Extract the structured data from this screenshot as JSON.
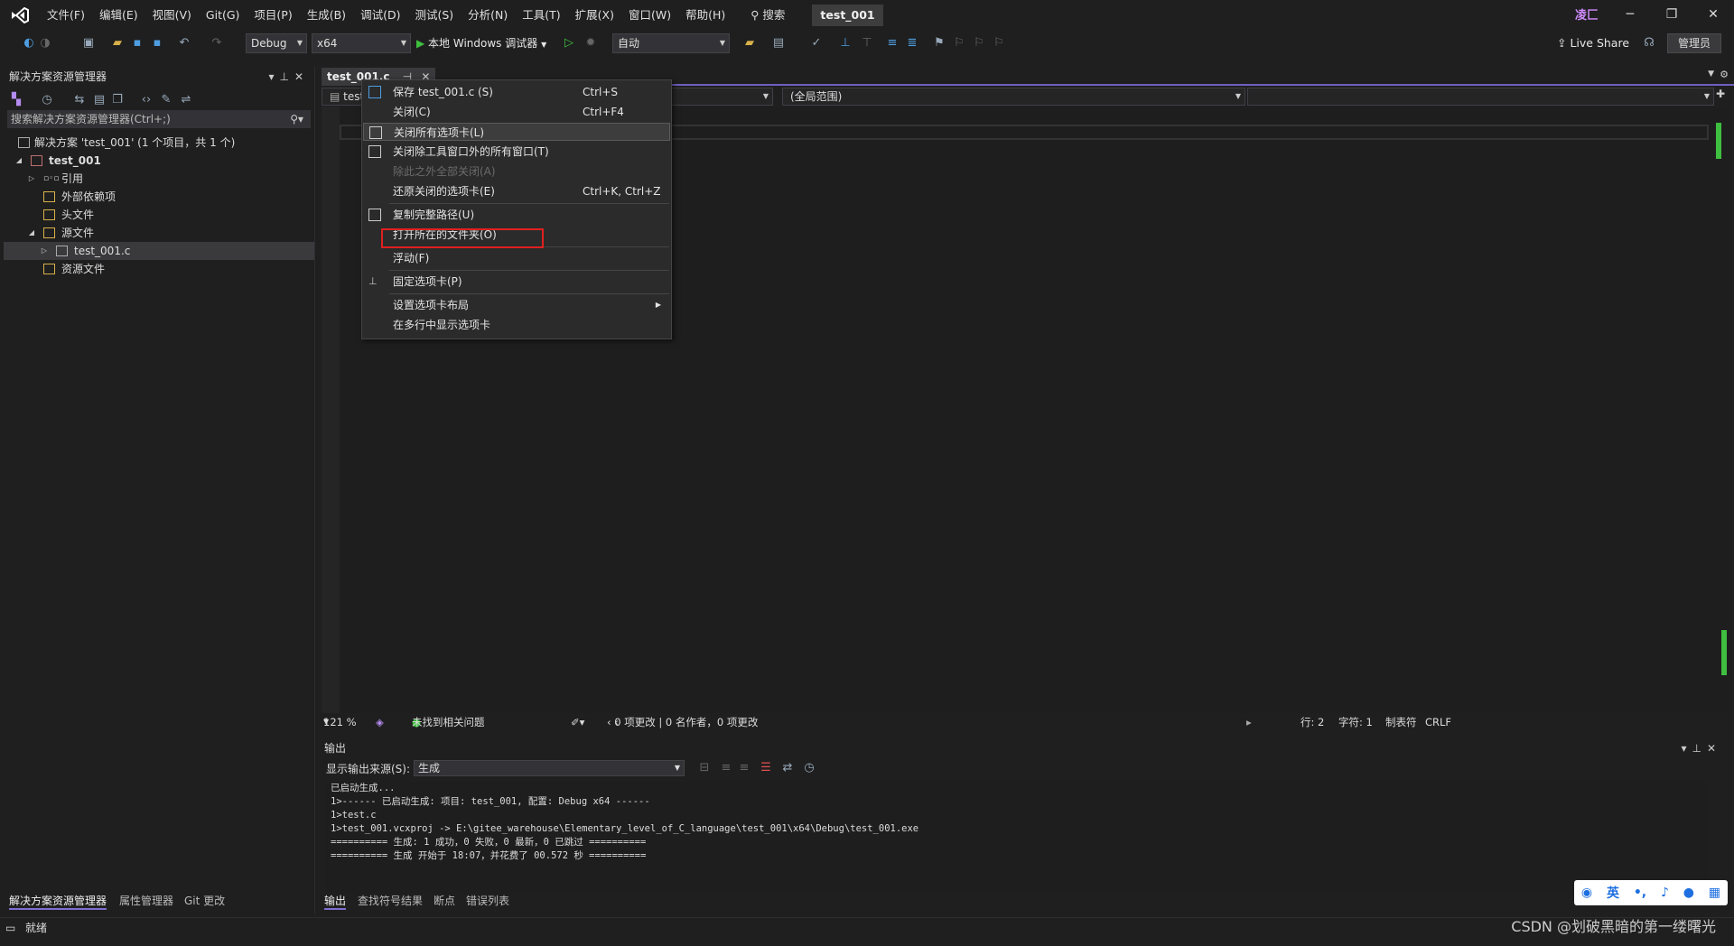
{
  "menubar": {
    "items": [
      "文件(F)",
      "编辑(E)",
      "视图(V)",
      "Git(G)",
      "项目(P)",
      "生成(B)",
      "调试(D)",
      "测试(S)",
      "分析(N)",
      "工具(T)",
      "扩展(X)",
      "窗口(W)",
      "帮助(H)"
    ],
    "search_label": "搜索",
    "project_title": "test_001",
    "user_badge": "凌匚"
  },
  "toolbar": {
    "config": "Debug",
    "platform": "x64",
    "run_label": "本地 Windows 调试器",
    "target_mode": "自动",
    "liveshare_label": "Live Share",
    "admin_label": "管理员"
  },
  "solution_explorer": {
    "title": "解决方案资源管理器",
    "search_placeholder": "搜索解决方案资源管理器(Ctrl+;)",
    "tree": [
      {
        "label": "解决方案 'test_001' (1 个项目，共 1 个)"
      },
      {
        "label": "test_001"
      },
      {
        "label": "引用"
      },
      {
        "label": "外部依赖项"
      },
      {
        "label": "头文件"
      },
      {
        "label": "源文件"
      },
      {
        "label": "test_001.c"
      },
      {
        "label": "资源文件"
      }
    ],
    "tabs": [
      "解决方案资源管理器",
      "属性管理器",
      "Git 更改"
    ]
  },
  "document": {
    "tab_label": "test_001.c",
    "nav_left": "test_",
    "nav_scope": "(全局范围)"
  },
  "context_menu": {
    "items": [
      {
        "label": "保存 test_001.c (S)",
        "shortcut": "Ctrl+S"
      },
      {
        "label": "关闭(C)",
        "shortcut": "Ctrl+F4"
      },
      {
        "label": "关闭所有选项卡(L)",
        "shortcut": ""
      },
      {
        "label": "关闭除工具窗口外的所有窗口(T)",
        "shortcut": ""
      },
      {
        "label": "除此之外全部关闭(A)",
        "shortcut": ""
      },
      {
        "label": "还原关闭的选项卡(E)",
        "shortcut": "Ctrl+K, Ctrl+Z"
      },
      {
        "label": "复制完整路径(U)",
        "shortcut": ""
      },
      {
        "label": "打开所在的文件夹(O)",
        "shortcut": ""
      },
      {
        "label": "浮动(F)",
        "shortcut": ""
      },
      {
        "label": "固定选项卡(P)",
        "shortcut": ""
      },
      {
        "label": "设置选项卡布局",
        "shortcut": ""
      },
      {
        "label": "在多行中显示选项卡",
        "shortcut": ""
      }
    ]
  },
  "editor_status": {
    "zoom": "121 %",
    "issues": "未找到相关问题",
    "changes": "0 项更改 | 0 名作者，0 项更改",
    "line": "行: 2",
    "char": "字符: 1",
    "tabs": "制表符",
    "eol": "CRLF"
  },
  "output": {
    "title": "输出",
    "source_label": "显示输出来源(S):",
    "source_value": "生成",
    "lines": [
      "已启动生成...",
      "1>------ 已启动生成: 项目: test_001, 配置: Debug x64 ------",
      "1>test.c",
      "1>test_001.vcxproj -> E:\\gitee_warehouse\\Elementary_level_of_C_language\\test_001\\x64\\Debug\\test_001.exe",
      "========== 生成: 1 成功，0 失败，0 最新，0 已跳过 ==========",
      "========== 生成 开始于 18:07，并花费了 00.572 秒 =========="
    ],
    "tabs": [
      "输出",
      "查找符号结果",
      "断点",
      "错误列表"
    ]
  },
  "statusbar": {
    "ready": "就绪",
    "watermark": "CSDN @划破黑暗的第一缕曙光"
  },
  "ime": {
    "lang": "英"
  }
}
